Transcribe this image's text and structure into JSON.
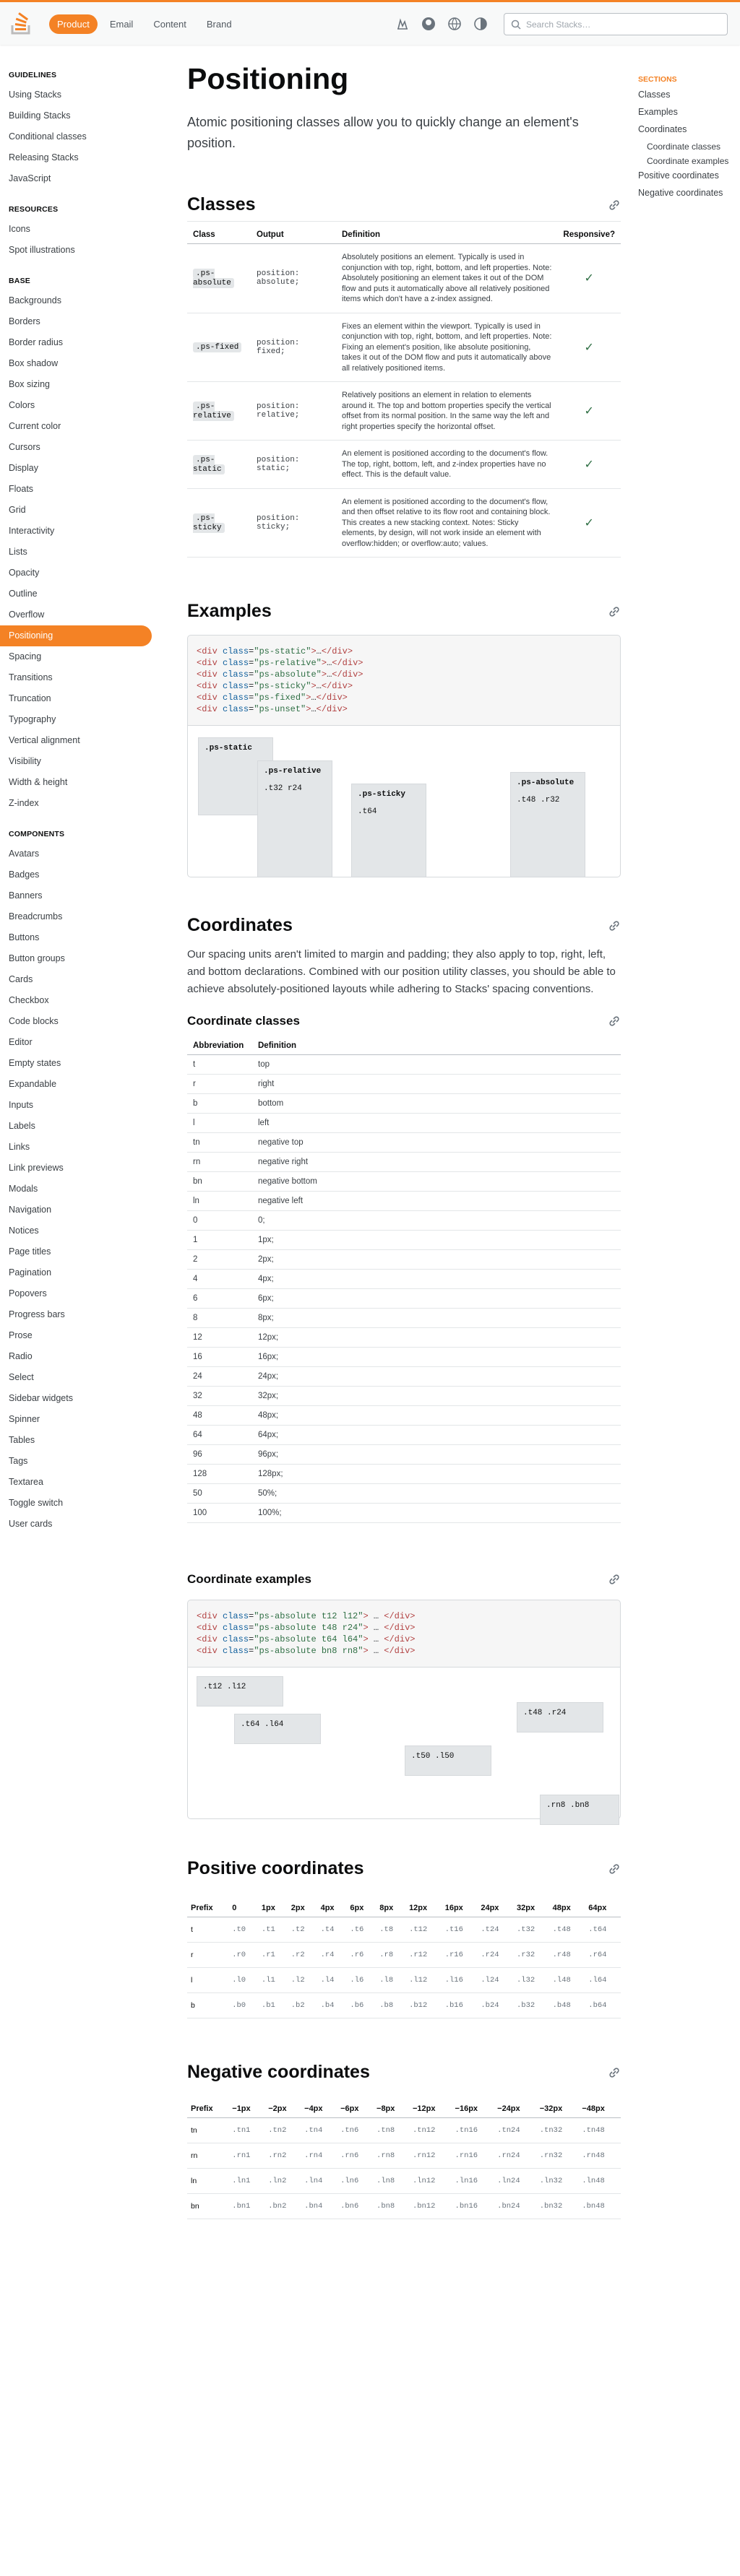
{
  "header": {
    "tabs": [
      "Product",
      "Email",
      "Content",
      "Brand"
    ],
    "search_placeholder": "Search Stacks…"
  },
  "sidebar": {
    "groups": [
      {
        "title": "Guidelines",
        "items": [
          "Using Stacks",
          "Building Stacks",
          "Conditional classes",
          "Releasing Stacks",
          "JavaScript"
        ]
      },
      {
        "title": "Resources",
        "items": [
          "Icons",
          "Spot illustrations"
        ]
      },
      {
        "title": "Base",
        "items": [
          "Backgrounds",
          "Borders",
          "Border radius",
          "Box shadow",
          "Box sizing",
          "Colors",
          "Current color",
          "Cursors",
          "Display",
          "Floats",
          "Grid",
          "Interactivity",
          "Lists",
          "Opacity",
          "Outline",
          "Overflow",
          "Positioning",
          "Spacing",
          "Transitions",
          "Truncation",
          "Typography",
          "Vertical alignment",
          "Visibility",
          "Width & height",
          "Z-index"
        ]
      },
      {
        "title": "Components",
        "items": [
          "Avatars",
          "Badges",
          "Banners",
          "Breadcrumbs",
          "Buttons",
          "Button groups",
          "Cards",
          "Checkbox",
          "Code blocks",
          "Editor",
          "Empty states",
          "Expandable",
          "Inputs",
          "Labels",
          "Links",
          "Link previews",
          "Modals",
          "Navigation",
          "Notices",
          "Page titles",
          "Pagination",
          "Popovers",
          "Progress bars",
          "Prose",
          "Radio",
          "Select",
          "Sidebar widgets",
          "Spinner",
          "Tables",
          "Tags",
          "Textarea",
          "Toggle switch",
          "User cards"
        ]
      }
    ],
    "active": "Positioning"
  },
  "page": {
    "title": "Positioning",
    "lead": "Atomic positioning classes allow you to quickly change an element's position."
  },
  "classes": {
    "heading": "Classes",
    "columns": [
      "Class",
      "Output",
      "Definition",
      "Responsive?"
    ],
    "rows": [
      {
        "cls": ".ps-absolute",
        "out": "position: absolute;",
        "def": "Absolutely positions an element. Typically is used in conjunction with top, right, bottom, and left properties. Note: Absolutely positioning an element takes it out of the DOM flow and puts it automatically above all relatively positioned items which don't have a z-index assigned.",
        "resp": "✓"
      },
      {
        "cls": ".ps-fixed",
        "out": "position: fixed;",
        "def": "Fixes an element within the viewport. Typically is used in conjunction with top, right, bottom, and left properties. Note: Fixing an element's position, like absolute positioning, takes it out of the DOM flow and puts it automatically above all relatively positioned items.",
        "resp": "✓"
      },
      {
        "cls": ".ps-relative",
        "out": "position: relative;",
        "def": "Relatively positions an element in relation to elements around it. The top and bottom properties specify the vertical offset from its normal position. In the same way the left and right properties specify the horizontal offset.",
        "resp": "✓"
      },
      {
        "cls": ".ps-static",
        "out": "position: static;",
        "def": "An element is positioned according to the document's flow. The top, right, bottom, left, and z-index properties have no effect. This is the default value.",
        "resp": "✓"
      },
      {
        "cls": ".ps-sticky",
        "out": "position: sticky;",
        "def": "An element is positioned according to the document's flow, and then offset relative to its flow root and containing block. This creates a new stacking context. Notes: Sticky elements, by design, will not work inside an element with overflow:hidden; or overflow:auto; values.",
        "resp": "✓"
      }
    ]
  },
  "examples": {
    "heading": "Examples",
    "code": [
      {
        "cls": "ps-static"
      },
      {
        "cls": "ps-relative"
      },
      {
        "cls": "ps-absolute"
      },
      {
        "cls": "ps-sticky"
      },
      {
        "cls": "ps-fixed"
      },
      {
        "cls": "ps-unset"
      }
    ],
    "boxes": {
      "static": ".ps-static",
      "relative": ".ps-relative",
      "relative_vals": ".t32 r24",
      "sticky": ".ps-sticky",
      "sticky_vals": ".t64",
      "absolute": ".ps-absolute",
      "absolute_vals": ".t48 .r32"
    }
  },
  "coordinates": {
    "heading": "Coordinates",
    "lead": "Our spacing units aren't limited to margin and padding; they also apply to top, right, left, and bottom declarations. Combined with our position utility classes, you should be able to achieve absolutely-positioned layouts while adhering to Stacks' spacing conventions.",
    "classes_heading": "Coordinate classes",
    "columns": [
      "Abbreviation",
      "Definition"
    ],
    "rows": [
      [
        "t",
        "top"
      ],
      [
        "r",
        "right"
      ],
      [
        "b",
        "bottom"
      ],
      [
        "l",
        "left"
      ],
      [
        "tn",
        "negative top"
      ],
      [
        "rn",
        "negative right"
      ],
      [
        "bn",
        "negative bottom"
      ],
      [
        "ln",
        "negative left"
      ],
      [
        "0",
        "0;"
      ],
      [
        "1",
        "1px;"
      ],
      [
        "2",
        "2px;"
      ],
      [
        "4",
        "4px;"
      ],
      [
        "6",
        "6px;"
      ],
      [
        "8",
        "8px;"
      ],
      [
        "12",
        "12px;"
      ],
      [
        "16",
        "16px;"
      ],
      [
        "24",
        "24px;"
      ],
      [
        "32",
        "32px;"
      ],
      [
        "48",
        "48px;"
      ],
      [
        "64",
        "64px;"
      ],
      [
        "96",
        "96px;"
      ],
      [
        "128",
        "128px;"
      ],
      [
        "50",
        "50%;"
      ],
      [
        "100",
        "100%;"
      ]
    ]
  },
  "coord_examples": {
    "heading": "Coordinate examples",
    "code": [
      "ps-absolute t12 l12",
      "ps-absolute t48 r24",
      "ps-absolute t64 l64",
      "ps-absolute bn8 rn8"
    ],
    "boxes": [
      ".t12 .l12",
      ".t64 .l64",
      ".t50 .l50",
      ".t48 .r24",
      ".rn8 .bn8"
    ]
  },
  "positive": {
    "heading": "Positive coordinates",
    "columns": [
      "Prefix",
      "0",
      "1px",
      "2px",
      "4px",
      "6px",
      "8px",
      "12px",
      "16px",
      "24px",
      "32px",
      "48px",
      "64px"
    ],
    "rows": [
      [
        "t",
        ".t0",
        ".t1",
        ".t2",
        ".t4",
        ".t6",
        ".t8",
        ".t12",
        ".t16",
        ".t24",
        ".t32",
        ".t48",
        ".t64"
      ],
      [
        "r",
        ".r0",
        ".r1",
        ".r2",
        ".r4",
        ".r6",
        ".r8",
        ".r12",
        ".r16",
        ".r24",
        ".r32",
        ".r48",
        ".r64"
      ],
      [
        "l",
        ".l0",
        ".l1",
        ".l2",
        ".l4",
        ".l6",
        ".l8",
        ".l12",
        ".l16",
        ".l24",
        ".l32",
        ".l48",
        ".l64"
      ],
      [
        "b",
        ".b0",
        ".b1",
        ".b2",
        ".b4",
        ".b6",
        ".b8",
        ".b12",
        ".b16",
        ".b24",
        ".b32",
        ".b48",
        ".b64"
      ]
    ]
  },
  "negative": {
    "heading": "Negative coordinates",
    "columns": [
      "Prefix",
      "−1px",
      "−2px",
      "−4px",
      "−6px",
      "−8px",
      "−12px",
      "−16px",
      "−24px",
      "−32px",
      "−48px"
    ],
    "rows": [
      [
        "tn",
        ".tn1",
        ".tn2",
        ".tn4",
        ".tn6",
        ".tn8",
        ".tn12",
        ".tn16",
        ".tn24",
        ".tn32",
        ".tn48"
      ],
      [
        "rn",
        ".rn1",
        ".rn2",
        ".rn4",
        ".rn6",
        ".rn8",
        ".rn12",
        ".rn16",
        ".rn24",
        ".rn32",
        ".rn48"
      ],
      [
        "ln",
        ".ln1",
        ".ln2",
        ".ln4",
        ".ln6",
        ".ln8",
        ".ln12",
        ".ln16",
        ".ln24",
        ".ln32",
        ".ln48"
      ],
      [
        "bn",
        ".bn1",
        ".bn2",
        ".bn4",
        ".bn6",
        ".bn8",
        ".bn12",
        ".bn16",
        ".bn24",
        ".bn32",
        ".bn48"
      ]
    ]
  },
  "toc": {
    "heading": "Sections",
    "items": [
      {
        "label": "Classes",
        "sub": false
      },
      {
        "label": "Examples",
        "sub": false
      },
      {
        "label": "Coordinates",
        "sub": false
      },
      {
        "label": "Coordinate classes",
        "sub": true
      },
      {
        "label": "Coordinate examples",
        "sub": true
      },
      {
        "label": "Positive coordinates",
        "sub": false
      },
      {
        "label": "Negative coordinates",
        "sub": false
      }
    ]
  },
  "colors": {
    "accent": "#f48225",
    "check": "#2f6f44"
  }
}
